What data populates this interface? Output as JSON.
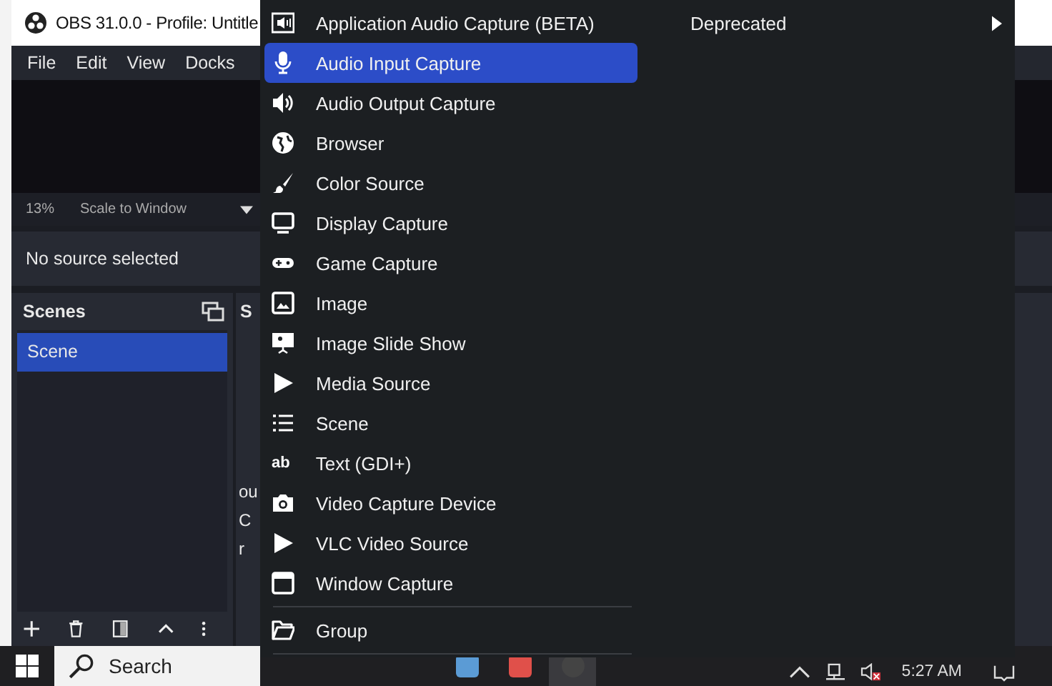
{
  "window": {
    "title": "OBS 31.0.0 - Profile: Untitle"
  },
  "menu_bar": [
    "File",
    "Edit",
    "View",
    "Docks"
  ],
  "preview_bar": {
    "zoom": "13%",
    "scale_mode": "Scale to Window"
  },
  "context_bar": {
    "text": "No source selected"
  },
  "scenes_dock": {
    "title": "Scenes",
    "items": [
      {
        "label": "Scene",
        "selected": true
      }
    ]
  },
  "sources_dock": {
    "title": "S",
    "hint_lines": [
      "ou",
      "C",
      "r"
    ]
  },
  "context_menu": {
    "items": [
      {
        "label": "Application Audio Capture (BETA)",
        "kind": "app-audio",
        "selected": false
      },
      {
        "label": "Audio Input Capture",
        "kind": "mic",
        "selected": true
      },
      {
        "label": "Audio Output Capture",
        "kind": "speaker",
        "selected": false
      },
      {
        "label": "Browser",
        "kind": "globe",
        "selected": false
      },
      {
        "label": "Color Source",
        "kind": "brush",
        "selected": false
      },
      {
        "label": "Display Capture",
        "kind": "monitor",
        "selected": false
      },
      {
        "label": "Game Capture",
        "kind": "gamepad",
        "selected": false
      },
      {
        "label": "Image",
        "kind": "image",
        "selected": false
      },
      {
        "label": "Image Slide Show",
        "kind": "slideshow",
        "selected": false
      },
      {
        "label": "Media Source",
        "kind": "play",
        "selected": false
      },
      {
        "label": "Scene",
        "kind": "list",
        "selected": false
      },
      {
        "label": "Text (GDI+)",
        "kind": "text",
        "glyph": "ab",
        "selected": false
      },
      {
        "label": "Video Capture Device",
        "kind": "camera",
        "selected": false
      },
      {
        "label": "VLC Video Source",
        "kind": "play",
        "selected": false
      },
      {
        "label": "Window Capture",
        "kind": "window",
        "selected": false
      }
    ],
    "group_item": {
      "label": "Group",
      "kind": "folder",
      "selected": false
    },
    "submenus": [
      {
        "label": "Deprecated"
      }
    ]
  },
  "taskbar": {
    "search_placeholder": "Search",
    "time": "5:27 AM"
  }
}
